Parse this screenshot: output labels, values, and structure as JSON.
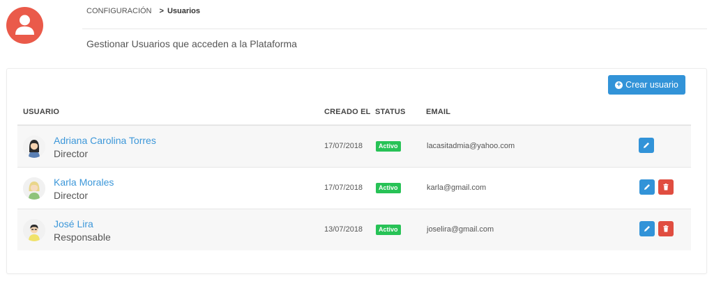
{
  "header": {
    "breadcrumb_parent": "CONFIGURACIÓN",
    "breadcrumb_sep": ">",
    "breadcrumb_current": "Usuarios",
    "subtitle": "Gestionar Usuarios que acceden a la Plataforma",
    "avatar_icon": "user-icon"
  },
  "actions": {
    "create_label": "Crear usuario",
    "create_icon": "plus-circle-icon"
  },
  "table": {
    "columns": {
      "user": "USUARIO",
      "created": "CREADO EL",
      "status": "STATUS",
      "email": "EMAIL"
    },
    "rows": [
      {
        "name": "Adriana Carolina Torres",
        "role": "Director",
        "created": "17/07/2018",
        "status": "Activo",
        "email": "lacasitadmia@yahoo.com",
        "avatar": "woman-dark-hair-avatar",
        "can_delete": false
      },
      {
        "name": "Karla Morales",
        "role": "Director",
        "created": "17/07/2018",
        "status": "Activo",
        "email": "karla@gmail.com",
        "avatar": "woman-blonde-avatar",
        "can_delete": true
      },
      {
        "name": "José Lira",
        "role": "Responsable",
        "created": "13/07/2018",
        "status": "Activo",
        "email": "joselira@gmail.com",
        "avatar": "man-dark-hair-avatar",
        "can_delete": true
      }
    ]
  },
  "colors": {
    "accent": "#3293d8",
    "danger": "#e04d40",
    "active": "#27c256",
    "header_avatar": "#ea5a4a",
    "link": "#3c97d9"
  },
  "icons": {
    "edit": "pencil-icon",
    "delete": "trash-icon"
  }
}
